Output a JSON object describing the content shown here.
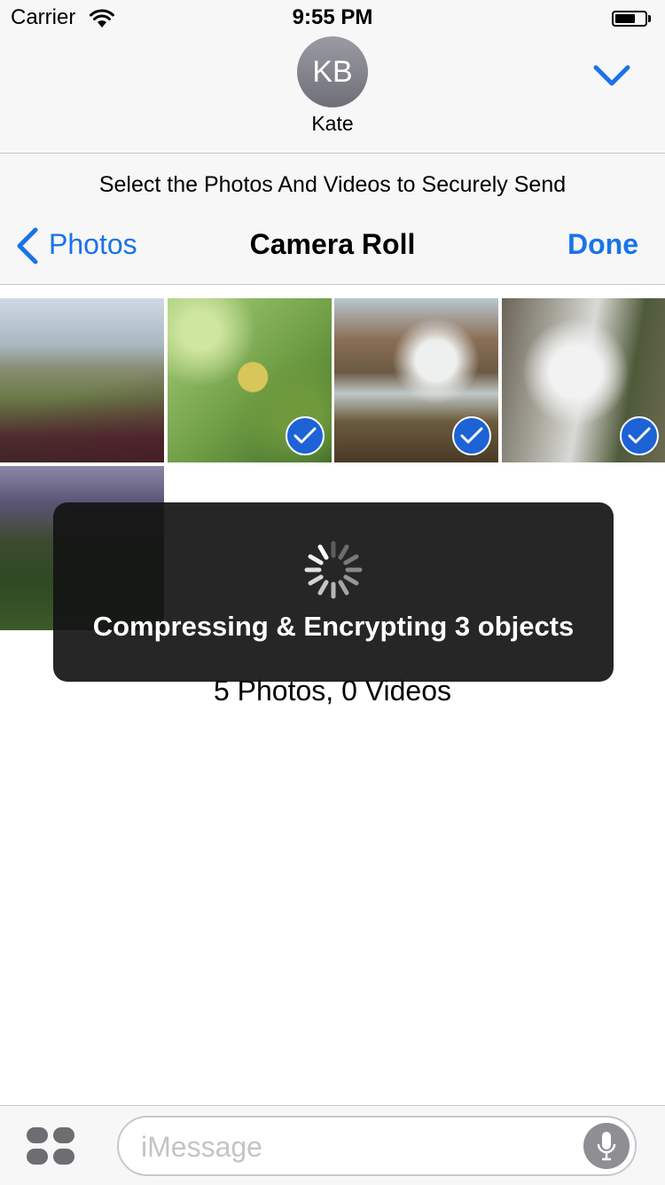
{
  "status_bar": {
    "carrier": "Carrier",
    "time": "9:55 PM",
    "battery_level": 0.7
  },
  "contact": {
    "initials": "KB",
    "name": "Kate"
  },
  "picker": {
    "prompt": "Select the Photos And Videos to Securely Send",
    "back_label": "Photos",
    "title": "Camera Roll",
    "done_label": "Done",
    "summary": "5 Photos, 0 Videos",
    "photos": [
      {
        "selected": false
      },
      {
        "selected": true
      },
      {
        "selected": true
      },
      {
        "selected": true
      },
      {
        "selected": false
      }
    ]
  },
  "hud": {
    "message": "Compressing & Encrypting 3 objects"
  },
  "input_bar": {
    "placeholder": "iMessage"
  },
  "colors": {
    "accent": "#1a73e8",
    "check_badge": "#1d63d6",
    "hud_bg": "#141414"
  },
  "icons": {
    "wifi": "wifi-icon",
    "battery": "battery-icon",
    "collapse": "chevron-down-icon",
    "back": "chevron-left-icon",
    "check": "checkmark-icon",
    "spinner": "spinner-icon",
    "apps": "app-drawer-icon",
    "mic": "microphone-icon"
  }
}
